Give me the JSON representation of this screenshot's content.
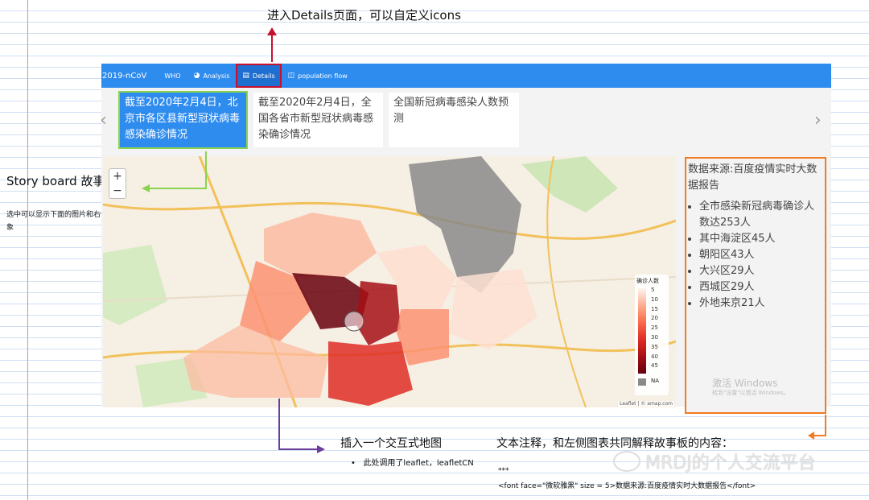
{
  "annotations": {
    "top": "进入Details页面，可以自定义icons",
    "story_title": "Story board  故事板",
    "story_desc": "选中可以显示下面的图片和右侧的文本对象",
    "map_title": "插入一个交互式地图",
    "map_bullet": "此处调用了leaflet，leafletCN",
    "text_title": "文本注释，和左侧图表共同解释故事板的内容：",
    "stars": "***",
    "code": "<font face=\"微软雅黑\" size = 5>数据来源:百度疫情实时大数据报告</font>",
    "watermark": "MRDJ的个人交流平台"
  },
  "navbar": {
    "brand": "2019-nCoV",
    "items": [
      {
        "label": "WHO",
        "icon": ""
      },
      {
        "label": "Analysis",
        "icon": "pie-chart-icon"
      },
      {
        "label": "Details",
        "icon": "details-icon"
      },
      {
        "label": "population flow",
        "icon": "map-icon"
      }
    ]
  },
  "storyboard": {
    "slides": [
      "截至2020年2月4日，北京市各区县新型冠状病毒感染确诊情况",
      "截至2020年2月4日，全国各省市新型冠状病毒感染确诊情况",
      "全国新冠病毒感染人数预测"
    ],
    "active_index": 0
  },
  "map": {
    "zoom_in": "+",
    "zoom_out": "−",
    "legend_title": "确诊人数",
    "legend_ticks": [
      "5",
      "10",
      "15",
      "20",
      "25",
      "30",
      "35",
      "40",
      "45"
    ],
    "legend_na": "NA",
    "attribution": "Leaflet | © amap.com",
    "colors": {
      "low": "#fee0d2",
      "high": "#67000d",
      "na": "#8a8a8a"
    }
  },
  "panel": {
    "title": "数据来源:百度疫情实时大数据报告",
    "items": [
      "全市感染新冠病毒确诊人数达253人",
      "其中海淀区45人",
      "朝阳区43人",
      "大兴区29人",
      "西城区29人",
      "外地来京21人"
    ],
    "activation": "激活 Windows",
    "activation_sub": "转到\"设置\"以激活 Windows。"
  },
  "colors": {
    "navbar": "#2f8cef",
    "highlight_red": "#c8102e",
    "story_green": "#8ad34f",
    "panel_orange": "#f07b20",
    "map_purple": "#6a3d9a"
  }
}
